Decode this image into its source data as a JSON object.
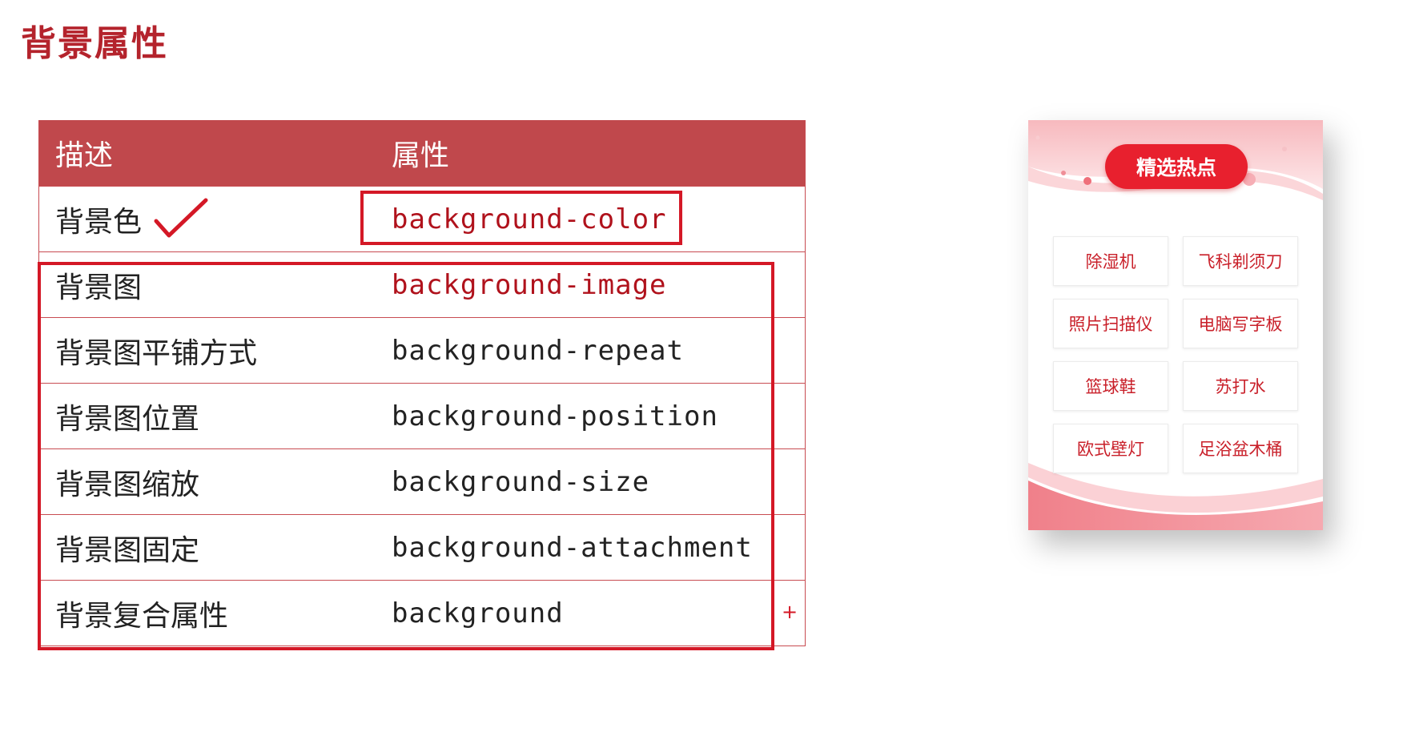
{
  "page": {
    "title": "背景属性"
  },
  "table": {
    "headers": [
      "描述",
      "属性"
    ],
    "rows": [
      {
        "desc": "背景色",
        "prop": "background-color",
        "checked": true
      },
      {
        "desc": "背景图",
        "prop": "background-image"
      },
      {
        "desc": "背景图平铺方式",
        "prop": "background-repeat"
      },
      {
        "desc": "背景图位置",
        "prop": "background-position"
      },
      {
        "desc": "背景图缩放",
        "prop": "background-size"
      },
      {
        "desc": "背景图固定",
        "prop": "background-attachment"
      },
      {
        "desc": "背景复合属性",
        "prop": "background"
      }
    ],
    "plus": "+"
  },
  "hot": {
    "title": "精选热点",
    "items": [
      "除湿机",
      "飞科剃须刀",
      "照片扫描仪",
      "电脑写字板",
      "篮球鞋",
      "苏打水",
      "欧式壁灯",
      "足浴盆木桶"
    ]
  },
  "colors": {
    "accent": "#b4232c",
    "table_header": "#c0484c",
    "highlight": "#d41826",
    "hot_button": "#e8202e"
  }
}
